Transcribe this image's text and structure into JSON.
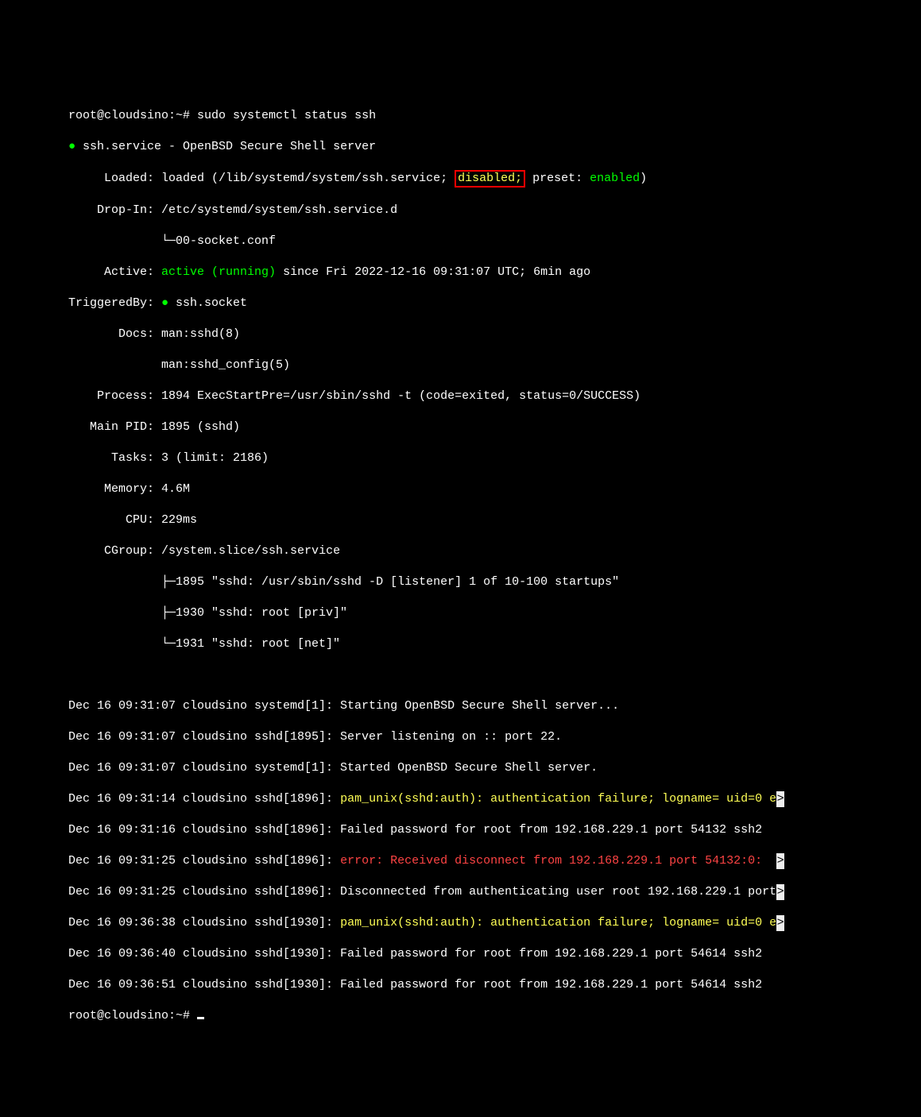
{
  "prompt1": "root@cloudsino:~# ",
  "cmd": "sudo systemctl status ssh",
  "bullet": "●",
  "service_line": " ssh.service - OpenBSD Secure Shell server",
  "loaded_label": "     Loaded: ",
  "loaded_pre": "loaded (/lib/systemd/system/ssh.service; ",
  "loaded_disabled": "disabled;",
  "loaded_mid": " preset: ",
  "loaded_enabled": "enabled",
  "loaded_post": ")",
  "dropin_label": "    Drop-In: ",
  "dropin_val": "/etc/systemd/system/ssh.service.d",
  "dropin_file": "             └─00-socket.conf",
  "active_label": "     Active: ",
  "active_val": "active (running)",
  "active_since": " since Fri 2022-12-16 09:31:07 UTC; 6min ago",
  "trig_label": "TriggeredBy: ",
  "trig_bullet": "●",
  "trig_val": " ssh.socket",
  "docs_label": "       Docs: ",
  "docs_val1": "man:sshd(8)",
  "docs_val2": "             man:sshd_config(5)",
  "process_label": "    Process: ",
  "process_val": "1894 ExecStartPre=/usr/sbin/sshd -t (code=exited, status=0/SUCCESS)",
  "mainpid_label": "   Main PID: ",
  "mainpid_val": "1895 (sshd)",
  "tasks_label": "      Tasks: ",
  "tasks_val": "3 (limit: 2186)",
  "memory_label": "     Memory: ",
  "memory_val": "4.6M",
  "cpu_label": "        CPU: ",
  "cpu_val": "229ms",
  "cgroup_label": "     CGroup: ",
  "cgroup_val": "/system.slice/ssh.service",
  "cg1": "             ├─1895 \"sshd: /usr/sbin/sshd -D [listener] 1 of 10-100 startups\"",
  "cg2": "             ├─1930 \"sshd: root [priv]\"",
  "cg3": "             └─1931 \"sshd: root [net]\"",
  "log1": "Dec 16 09:31:07 cloudsino systemd[1]: Starting OpenBSD Secure Shell server...",
  "log2": "Dec 16 09:31:07 cloudsino sshd[1895]: Server listening on :: port 22.",
  "log3": "Dec 16 09:31:07 cloudsino systemd[1]: Started OpenBSD Secure Shell server.",
  "log4a": "Dec 16 09:31:14 cloudsino sshd[1896]: ",
  "log4b": "pam_unix(sshd:auth): authentication failure; logname= uid=0 e",
  "log4s": ">",
  "log5": "Dec 16 09:31:16 cloudsino sshd[1896]: Failed password for root from 192.168.229.1 port 54132 ssh2",
  "log6a": "Dec 16 09:31:25 cloudsino sshd[1896]: ",
  "log6b": "error: Received disconnect from 192.168.229.1 port 54132:0:  ",
  "log6s": ">",
  "log7": "Dec 16 09:31:25 cloudsino sshd[1896]: Disconnected from authenticating user root 192.168.229.1 port",
  "log7s": ">",
  "log8a": "Dec 16 09:36:38 cloudsino sshd[1930]: ",
  "log8b": "pam_unix(sshd:auth): authentication failure; logname= uid=0 e",
  "log8s": ">",
  "log9": "Dec 16 09:36:40 cloudsino sshd[1930]: Failed password for root from 192.168.229.1 port 54614 ssh2",
  "log10": "Dec 16 09:36:51 cloudsino sshd[1930]: Failed password for root from 192.168.229.1 port 54614 ssh2",
  "prompt2": "root@cloudsino:~# "
}
